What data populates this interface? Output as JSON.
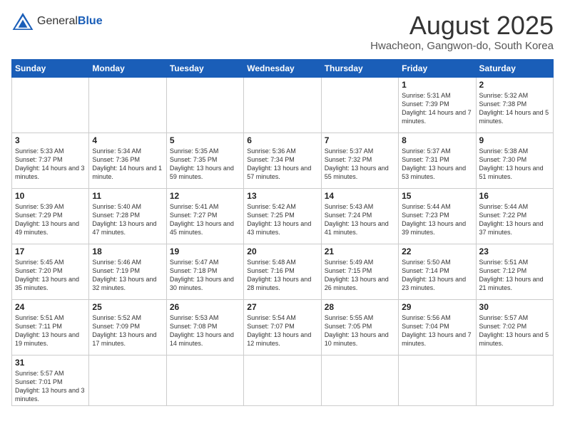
{
  "header": {
    "logo_general": "General",
    "logo_blue": "Blue",
    "title": "August 2025",
    "subtitle": "Hwacheon, Gangwon-do, South Korea"
  },
  "weekdays": [
    "Sunday",
    "Monday",
    "Tuesday",
    "Wednesday",
    "Thursday",
    "Friday",
    "Saturday"
  ],
  "weeks": [
    [
      {
        "day": "",
        "info": ""
      },
      {
        "day": "",
        "info": ""
      },
      {
        "day": "",
        "info": ""
      },
      {
        "day": "",
        "info": ""
      },
      {
        "day": "",
        "info": ""
      },
      {
        "day": "1",
        "info": "Sunrise: 5:31 AM\nSunset: 7:39 PM\nDaylight: 14 hours\nand 7 minutes."
      },
      {
        "day": "2",
        "info": "Sunrise: 5:32 AM\nSunset: 7:38 PM\nDaylight: 14 hours\nand 5 minutes."
      }
    ],
    [
      {
        "day": "3",
        "info": "Sunrise: 5:33 AM\nSunset: 7:37 PM\nDaylight: 14 hours\nand 3 minutes."
      },
      {
        "day": "4",
        "info": "Sunrise: 5:34 AM\nSunset: 7:36 PM\nDaylight: 14 hours\nand 1 minute."
      },
      {
        "day": "5",
        "info": "Sunrise: 5:35 AM\nSunset: 7:35 PM\nDaylight: 13 hours\nand 59 minutes."
      },
      {
        "day": "6",
        "info": "Sunrise: 5:36 AM\nSunset: 7:34 PM\nDaylight: 13 hours\nand 57 minutes."
      },
      {
        "day": "7",
        "info": "Sunrise: 5:37 AM\nSunset: 7:32 PM\nDaylight: 13 hours\nand 55 minutes."
      },
      {
        "day": "8",
        "info": "Sunrise: 5:37 AM\nSunset: 7:31 PM\nDaylight: 13 hours\nand 53 minutes."
      },
      {
        "day": "9",
        "info": "Sunrise: 5:38 AM\nSunset: 7:30 PM\nDaylight: 13 hours\nand 51 minutes."
      }
    ],
    [
      {
        "day": "10",
        "info": "Sunrise: 5:39 AM\nSunset: 7:29 PM\nDaylight: 13 hours\nand 49 minutes."
      },
      {
        "day": "11",
        "info": "Sunrise: 5:40 AM\nSunset: 7:28 PM\nDaylight: 13 hours\nand 47 minutes."
      },
      {
        "day": "12",
        "info": "Sunrise: 5:41 AM\nSunset: 7:27 PM\nDaylight: 13 hours\nand 45 minutes."
      },
      {
        "day": "13",
        "info": "Sunrise: 5:42 AM\nSunset: 7:25 PM\nDaylight: 13 hours\nand 43 minutes."
      },
      {
        "day": "14",
        "info": "Sunrise: 5:43 AM\nSunset: 7:24 PM\nDaylight: 13 hours\nand 41 minutes."
      },
      {
        "day": "15",
        "info": "Sunrise: 5:44 AM\nSunset: 7:23 PM\nDaylight: 13 hours\nand 39 minutes."
      },
      {
        "day": "16",
        "info": "Sunrise: 5:44 AM\nSunset: 7:22 PM\nDaylight: 13 hours\nand 37 minutes."
      }
    ],
    [
      {
        "day": "17",
        "info": "Sunrise: 5:45 AM\nSunset: 7:20 PM\nDaylight: 13 hours\nand 35 minutes."
      },
      {
        "day": "18",
        "info": "Sunrise: 5:46 AM\nSunset: 7:19 PM\nDaylight: 13 hours\nand 32 minutes."
      },
      {
        "day": "19",
        "info": "Sunrise: 5:47 AM\nSunset: 7:18 PM\nDaylight: 13 hours\nand 30 minutes."
      },
      {
        "day": "20",
        "info": "Sunrise: 5:48 AM\nSunset: 7:16 PM\nDaylight: 13 hours\nand 28 minutes."
      },
      {
        "day": "21",
        "info": "Sunrise: 5:49 AM\nSunset: 7:15 PM\nDaylight: 13 hours\nand 26 minutes."
      },
      {
        "day": "22",
        "info": "Sunrise: 5:50 AM\nSunset: 7:14 PM\nDaylight: 13 hours\nand 23 minutes."
      },
      {
        "day": "23",
        "info": "Sunrise: 5:51 AM\nSunset: 7:12 PM\nDaylight: 13 hours\nand 21 minutes."
      }
    ],
    [
      {
        "day": "24",
        "info": "Sunrise: 5:51 AM\nSunset: 7:11 PM\nDaylight: 13 hours\nand 19 minutes."
      },
      {
        "day": "25",
        "info": "Sunrise: 5:52 AM\nSunset: 7:09 PM\nDaylight: 13 hours\nand 17 minutes."
      },
      {
        "day": "26",
        "info": "Sunrise: 5:53 AM\nSunset: 7:08 PM\nDaylight: 13 hours\nand 14 minutes."
      },
      {
        "day": "27",
        "info": "Sunrise: 5:54 AM\nSunset: 7:07 PM\nDaylight: 13 hours\nand 12 minutes."
      },
      {
        "day": "28",
        "info": "Sunrise: 5:55 AM\nSunset: 7:05 PM\nDaylight: 13 hours\nand 10 minutes."
      },
      {
        "day": "29",
        "info": "Sunrise: 5:56 AM\nSunset: 7:04 PM\nDaylight: 13 hours\nand 7 minutes."
      },
      {
        "day": "30",
        "info": "Sunrise: 5:57 AM\nSunset: 7:02 PM\nDaylight: 13 hours\nand 5 minutes."
      }
    ],
    [
      {
        "day": "31",
        "info": "Sunrise: 5:57 AM\nSunset: 7:01 PM\nDaylight: 13 hours\nand 3 minutes."
      },
      {
        "day": "",
        "info": ""
      },
      {
        "day": "",
        "info": ""
      },
      {
        "day": "",
        "info": ""
      },
      {
        "day": "",
        "info": ""
      },
      {
        "day": "",
        "info": ""
      },
      {
        "day": "",
        "info": ""
      }
    ]
  ]
}
